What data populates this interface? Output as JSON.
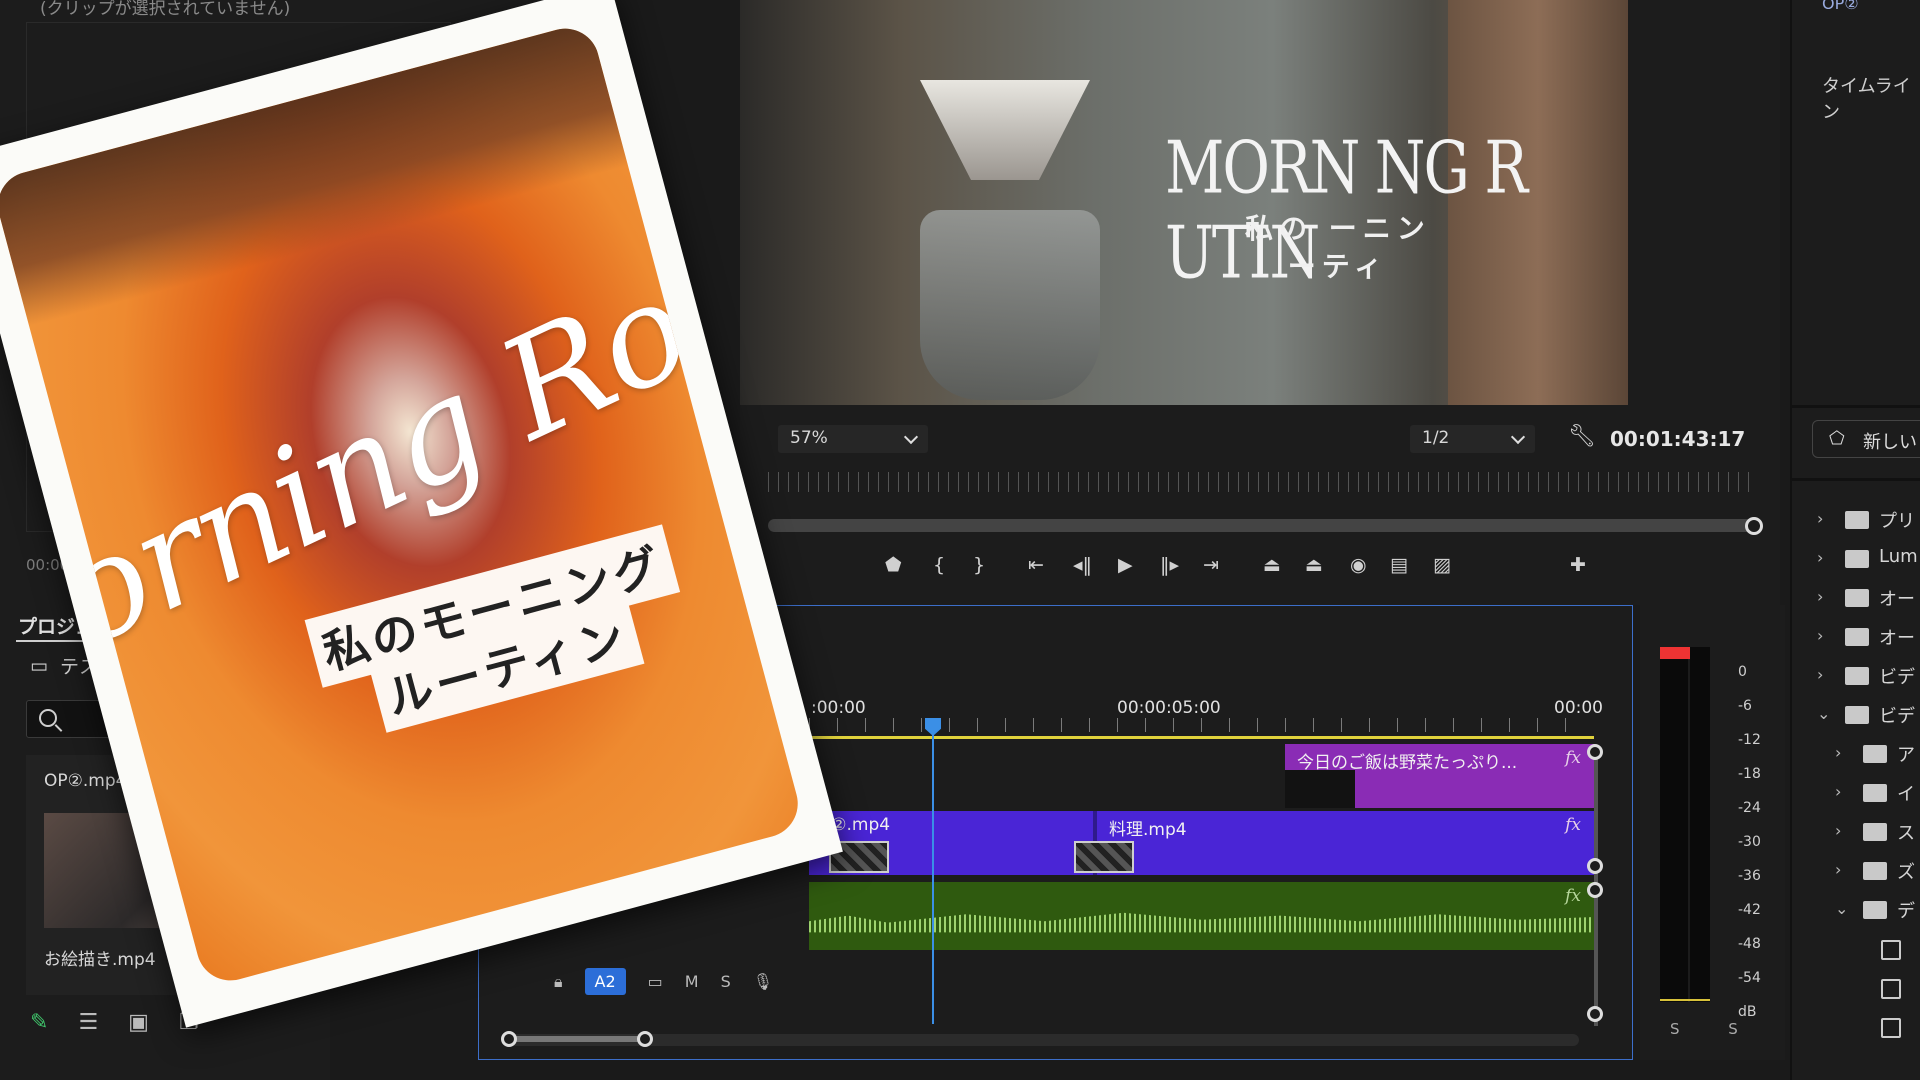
{
  "source_panel": {
    "hint": "(クリップが選択されていません)",
    "timecode": "00:00:01:1"
  },
  "project": {
    "title": "プロジェクト",
    "bin_name": "テスト",
    "search_placeholder": "",
    "clips": [
      "OP②.mp4",
      "お絵描き.mp4"
    ]
  },
  "thumbnail_card": {
    "script_title": "orning Ro",
    "line1": "私のモーニング",
    "line2": "ルーティン"
  },
  "program": {
    "title_en": "MORN NG R  UTIN",
    "title_jp_line1": "私の  ーニン",
    "title_jp_line2": "ーティ",
    "zoom": "57%",
    "resolution": "1/2",
    "timecode": "00:01:43:17"
  },
  "timeline": {
    "tc_start": ":00:00",
    "tc_mid": "00:00:05:00",
    "tc_end": "00:00",
    "v3_clip": "今日のご飯は野菜たっぷり...",
    "v2_clip_a": "P②.mp4",
    "v2_clip_b": "料理.mp4",
    "fx": "fx",
    "track": {
      "a2": "A2",
      "m": "M",
      "s": "S"
    }
  },
  "meter": {
    "scale": [
      "0",
      "-6",
      "-12",
      "-18",
      "-24",
      "-30",
      "-36",
      "-42",
      "-48",
      "-54",
      "dB"
    ],
    "solo": "S S"
  },
  "right_panel": {
    "top_label": "OP②",
    "timeline_label": "タイムライン",
    "new_button": "新しい",
    "folders": [
      {
        "label": "プリ",
        "level": 0,
        "chev": "›"
      },
      {
        "label": "Lum",
        "level": 0,
        "chev": "›"
      },
      {
        "label": "オー",
        "level": 0,
        "chev": "›"
      },
      {
        "label": "オー",
        "level": 0,
        "chev": "›"
      },
      {
        "label": "ビデ",
        "level": 0,
        "chev": "›"
      },
      {
        "label": "ビデ",
        "level": 0,
        "chev": "⌄"
      },
      {
        "label": "ア",
        "level": 1,
        "chev": "›"
      },
      {
        "label": "イ",
        "level": 1,
        "chev": "›"
      },
      {
        "label": "ス",
        "level": 1,
        "chev": "›"
      },
      {
        "label": "ズ",
        "level": 1,
        "chev": "›"
      },
      {
        "label": "デ",
        "level": 1,
        "chev": "⌄"
      }
    ]
  }
}
